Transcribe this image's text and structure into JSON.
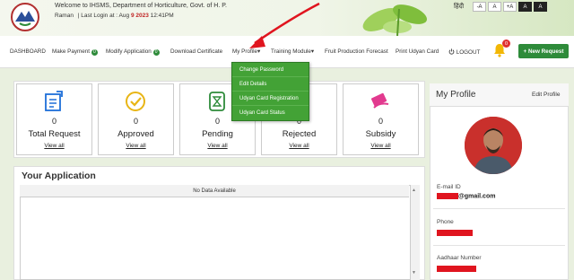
{
  "header": {
    "welcome": "Welcome to IHSMS, Department of Horticulture, Govt. of H. P.",
    "user": "Raman",
    "last_login_label": "| Last Login at : Aug",
    "last_login_date": "9 2023",
    "last_login_time": "12:41PM",
    "language": "हिंदी",
    "font_buttons": [
      "-A",
      "A",
      "+A",
      "A",
      "A"
    ]
  },
  "nav": {
    "items": [
      {
        "label": "DASHBOARD"
      },
      {
        "label": "Make Payment",
        "badge": "0"
      },
      {
        "label": "Modify Application",
        "badge": "0"
      },
      {
        "label": "Download Certificate"
      },
      {
        "label": "My Profile▾"
      },
      {
        "label": "Training Module▾"
      },
      {
        "label": "Fruit Production Forecast"
      },
      {
        "label": "Print Udyan Card"
      },
      {
        "label": "LOGOUT"
      }
    ],
    "notification_count": "0",
    "new_request": "+ New Request"
  },
  "dropdown": {
    "items": [
      "Change Password",
      "Edit Details",
      "Udyan Card Registration",
      "Udyan Card Status"
    ]
  },
  "stats": [
    {
      "label": "Total Request",
      "count": "0",
      "link": "View all",
      "icon": "total-request-icon"
    },
    {
      "label": "Approved",
      "count": "0",
      "link": "View all",
      "icon": "approved-icon"
    },
    {
      "label": "Pending",
      "count": "0",
      "link": "View all",
      "icon": "pending-icon"
    },
    {
      "label": "Rejected",
      "count": "0",
      "link": "View all",
      "icon": "rejected-icon"
    },
    {
      "label": "Subsidy",
      "count": "0",
      "link": "View all",
      "icon": "subsidy-icon"
    }
  ],
  "application": {
    "title": "Your Application",
    "empty_text": "No Data Available"
  },
  "profile": {
    "title": "My Profile",
    "edit_label": "Edit Profile",
    "email_label": "E-mail ID",
    "email_value": "@gmail.com",
    "phone_label": "Phone",
    "aadhaar_label": "Aadhaar Number"
  },
  "colors": {
    "accent_green": "#2e8b3a",
    "icon_blue": "#1e6fd9",
    "icon_yellow": "#e8b515",
    "icon_pink": "#e23a8f",
    "redaction": "#e0151f"
  }
}
